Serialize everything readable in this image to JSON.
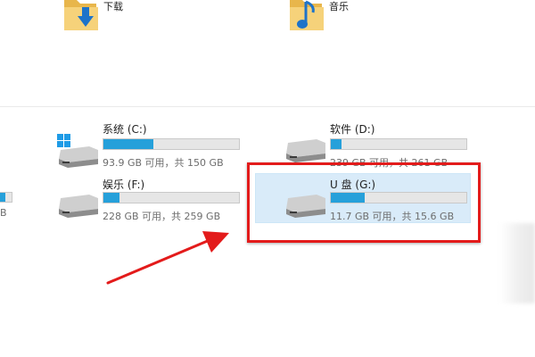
{
  "folders": [
    {
      "label": "下载",
      "icon": "folder-downloads-icon"
    },
    {
      "label": "音乐",
      "icon": "folder-music-icon"
    }
  ],
  "drives": [
    {
      "name": "系统 (C:)",
      "space": "93.9 GB 可用，共 150 GB",
      "used_fraction": 0.37,
      "icon": "windows-drive-icon"
    },
    {
      "name": "软件 (D:)",
      "space": "239 GB 可用，共 261 GB",
      "used_fraction": 0.08,
      "icon": "hard-drive-icon"
    },
    {
      "name": "娱乐 (F:)",
      "space": "228 GB 可用，共 259 GB",
      "used_fraction": 0.12,
      "icon": "hard-drive-icon"
    },
    {
      "name": "U 盘 (G:)",
      "space": "11.7 GB 可用，共 15.6 GB",
      "used_fraction": 0.25,
      "icon": "usb-drive-icon",
      "selected": true
    }
  ],
  "partial_left_drive": {
    "space": "B"
  },
  "colors": {
    "bar_fill": "#26a0da",
    "selection": "#d9ebf9",
    "annotation_red": "#e31b1b"
  }
}
